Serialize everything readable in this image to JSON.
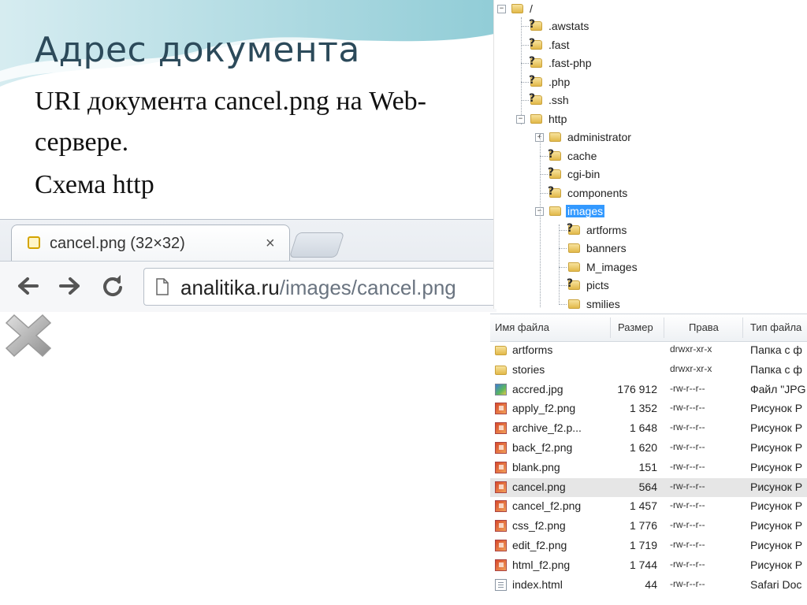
{
  "slide": {
    "title": "Адрес документа",
    "line1": "URI документа cancel.png на Web-",
    "line2": "сервере.",
    "line3": "Схема http"
  },
  "browser": {
    "tab_title": "cancel.png (32×32)",
    "tab_close": "×",
    "url_host": "analitika.ru",
    "url_path": "/images/cancel.png"
  },
  "tree": {
    "root": "/",
    "items": [
      {
        "label": ".awstats",
        "unknown": true
      },
      {
        "label": ".fast",
        "unknown": true
      },
      {
        "label": ".fast-php",
        "unknown": true
      },
      {
        "label": ".php",
        "unknown": true
      },
      {
        "label": ".ssh",
        "unknown": true
      },
      {
        "label": "http",
        "unknown": false
      },
      {
        "label": "administrator",
        "unknown": false
      },
      {
        "label": "cache",
        "unknown": true
      },
      {
        "label": "cgi-bin",
        "unknown": true
      },
      {
        "label": "components",
        "unknown": true
      },
      {
        "label": "images",
        "unknown": false,
        "selected": true
      },
      {
        "label": "artforms",
        "unknown": true
      },
      {
        "label": "banners",
        "unknown": false
      },
      {
        "label": "M_images",
        "unknown": false
      },
      {
        "label": "picts",
        "unknown": true
      },
      {
        "label": "smilies",
        "unknown": false
      }
    ]
  },
  "files": {
    "columns": [
      "Имя файла",
      "Размер",
      "Права",
      "Тип файла"
    ],
    "rows": [
      {
        "name": "artforms",
        "size": "",
        "perm": "drwxr-xr-x",
        "type": "Папка с ф",
        "icon": "folder"
      },
      {
        "name": "stories",
        "size": "",
        "perm": "drwxr-xr-x",
        "type": "Папка с ф",
        "icon": "folder"
      },
      {
        "name": "accred.jpg",
        "size": "176 912",
        "perm": "-rw-r--r--",
        "type": "Файл \"JPG",
        "icon": "jpg"
      },
      {
        "name": "apply_f2.png",
        "size": "1 352",
        "perm": "-rw-r--r--",
        "type": "Рисунок P",
        "icon": "png"
      },
      {
        "name": "archive_f2.p...",
        "size": "1 648",
        "perm": "-rw-r--r--",
        "type": "Рисунок P",
        "icon": "png"
      },
      {
        "name": "back_f2.png",
        "size": "1 620",
        "perm": "-rw-r--r--",
        "type": "Рисунок P",
        "icon": "png"
      },
      {
        "name": "blank.png",
        "size": "151",
        "perm": "-rw-r--r--",
        "type": "Рисунок P",
        "icon": "png"
      },
      {
        "name": "cancel.png",
        "size": "564",
        "perm": "-rw-r--r--",
        "type": "Рисунок P",
        "icon": "png",
        "selected": true
      },
      {
        "name": "cancel_f2.png",
        "size": "1 457",
        "perm": "-rw-r--r--",
        "type": "Рисунок P",
        "icon": "png"
      },
      {
        "name": "css_f2.png",
        "size": "1 776",
        "perm": "-rw-r--r--",
        "type": "Рисунок P",
        "icon": "png"
      },
      {
        "name": "edit_f2.png",
        "size": "1 719",
        "perm": "-rw-r--r--",
        "type": "Рисунок P",
        "icon": "png"
      },
      {
        "name": "html_f2.png",
        "size": "1 744",
        "perm": "-rw-r--r--",
        "type": "Рисунок P",
        "icon": "png"
      },
      {
        "name": "index.html",
        "size": "44",
        "perm": "-rw-r--r--",
        "type": "Safari Doc",
        "icon": "html"
      }
    ]
  }
}
